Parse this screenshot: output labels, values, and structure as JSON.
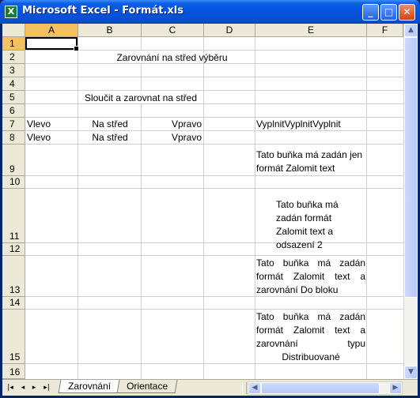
{
  "window": {
    "title": "Microsoft Excel - Formát.xls",
    "app_icon": "excel-icon",
    "buttons": {
      "minimize": "minimize-icon",
      "maximize": "maximize-icon",
      "close": "close-icon"
    }
  },
  "columns": [
    "A",
    "B",
    "C",
    "D",
    "E",
    "F"
  ],
  "rows": [
    "1",
    "2",
    "3",
    "4",
    "5",
    "6",
    "7",
    "8",
    "9",
    "10",
    "11",
    "12",
    "13",
    "14",
    "15",
    "16"
  ],
  "active_cell": "A1",
  "cells": {
    "r2": "Zarovnání na střed výběru",
    "r4": "Sloučit a zarovnat na střed",
    "r6a": "Vlevo",
    "r6b": "Na střed",
    "r6c": "Vpravo",
    "r6e": "VyplnitVyplnitVyplnit",
    "r7a": "Vlevo",
    "r7b": "Na střed",
    "r7c": "Vpravo",
    "r9e": "Tato buňka má zadán jen formát Zalomit text",
    "r11e": "Tato buňka má zadán formát Zalomit text a odsazení 2",
    "r13e": "Tato buňka má zadán formát Zalomit text a zarovnání Do bloku",
    "r15e": "Tato buňka má zadán formát Zalomit text a zarovnání typu Distribuované"
  },
  "sheet_tabs": [
    "Zarovnání",
    "Orientace"
  ],
  "active_tab": "Zarovnání",
  "nav_buttons": [
    "first-sheet-icon",
    "prev-sheet-icon",
    "next-sheet-icon",
    "last-sheet-icon"
  ],
  "colors": {
    "title_bar": "#0553de",
    "selected_header": "#f5c060",
    "gridline": "#d0d0d0",
    "chrome": "#ece9d8"
  }
}
